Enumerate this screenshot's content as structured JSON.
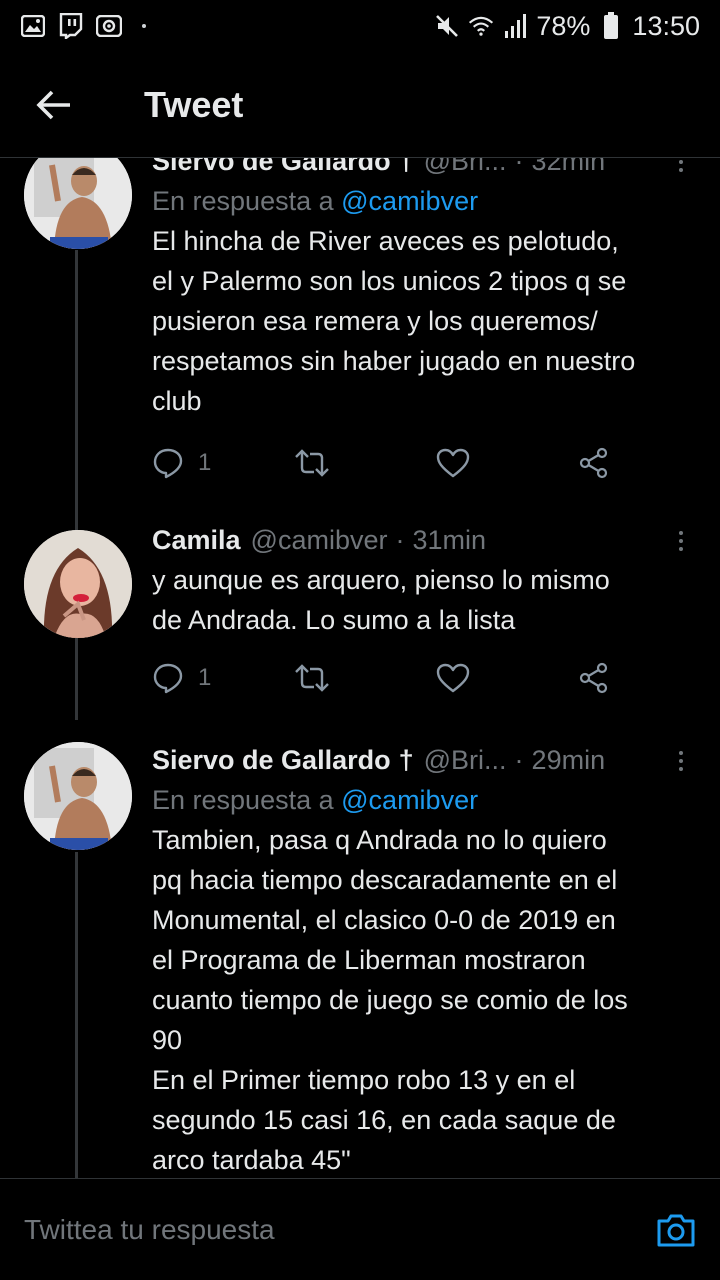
{
  "status_bar": {
    "battery": "78%",
    "time": "13:50"
  },
  "header": {
    "title": "Tweet"
  },
  "tweets": [
    {
      "name": "Siervo de Gallardo",
      "badge": "†",
      "handle": "@Bri...",
      "time": "32min",
      "reply_label": "En respuesta a",
      "reply_to": "@camibver",
      "text": "El hincha de River aveces es pelotudo,\nel y Palermo son los unicos 2 tipos q se\npusieron esa remera y los queremos/\nrespetamos sin haber jugado en nuestro\nclub",
      "replies": "1"
    },
    {
      "name": "Camila",
      "handle": "@camibver",
      "time": "31min",
      "text": "y aunque es arquero, pienso lo mismo\nde Andrada. Lo sumo a la lista",
      "replies": "1"
    },
    {
      "name": "Siervo de Gallardo",
      "badge": "†",
      "handle": "@Bri...",
      "time": "29min",
      "reply_label": "En respuesta a",
      "reply_to": "@camibver",
      "text": "Tambien, pasa q Andrada no lo quiero\npq hacia tiempo descaradamente en el\nMonumental, el clasico 0-0 de 2019 en\nel Programa de Liberman mostraron\ncuanto tiempo de juego se comio de los\n90\nEn el Primer tiempo robo 13 y en el\nsegundo 15 casi 16, en cada saque de\narco tardaba 45\""
    }
  ],
  "compose": {
    "placeholder": "Twittea tu respuesta"
  },
  "colors": {
    "background": "#000000",
    "text": "#e7e9ea",
    "secondary": "#71767b",
    "accent": "#1d9bf0"
  }
}
